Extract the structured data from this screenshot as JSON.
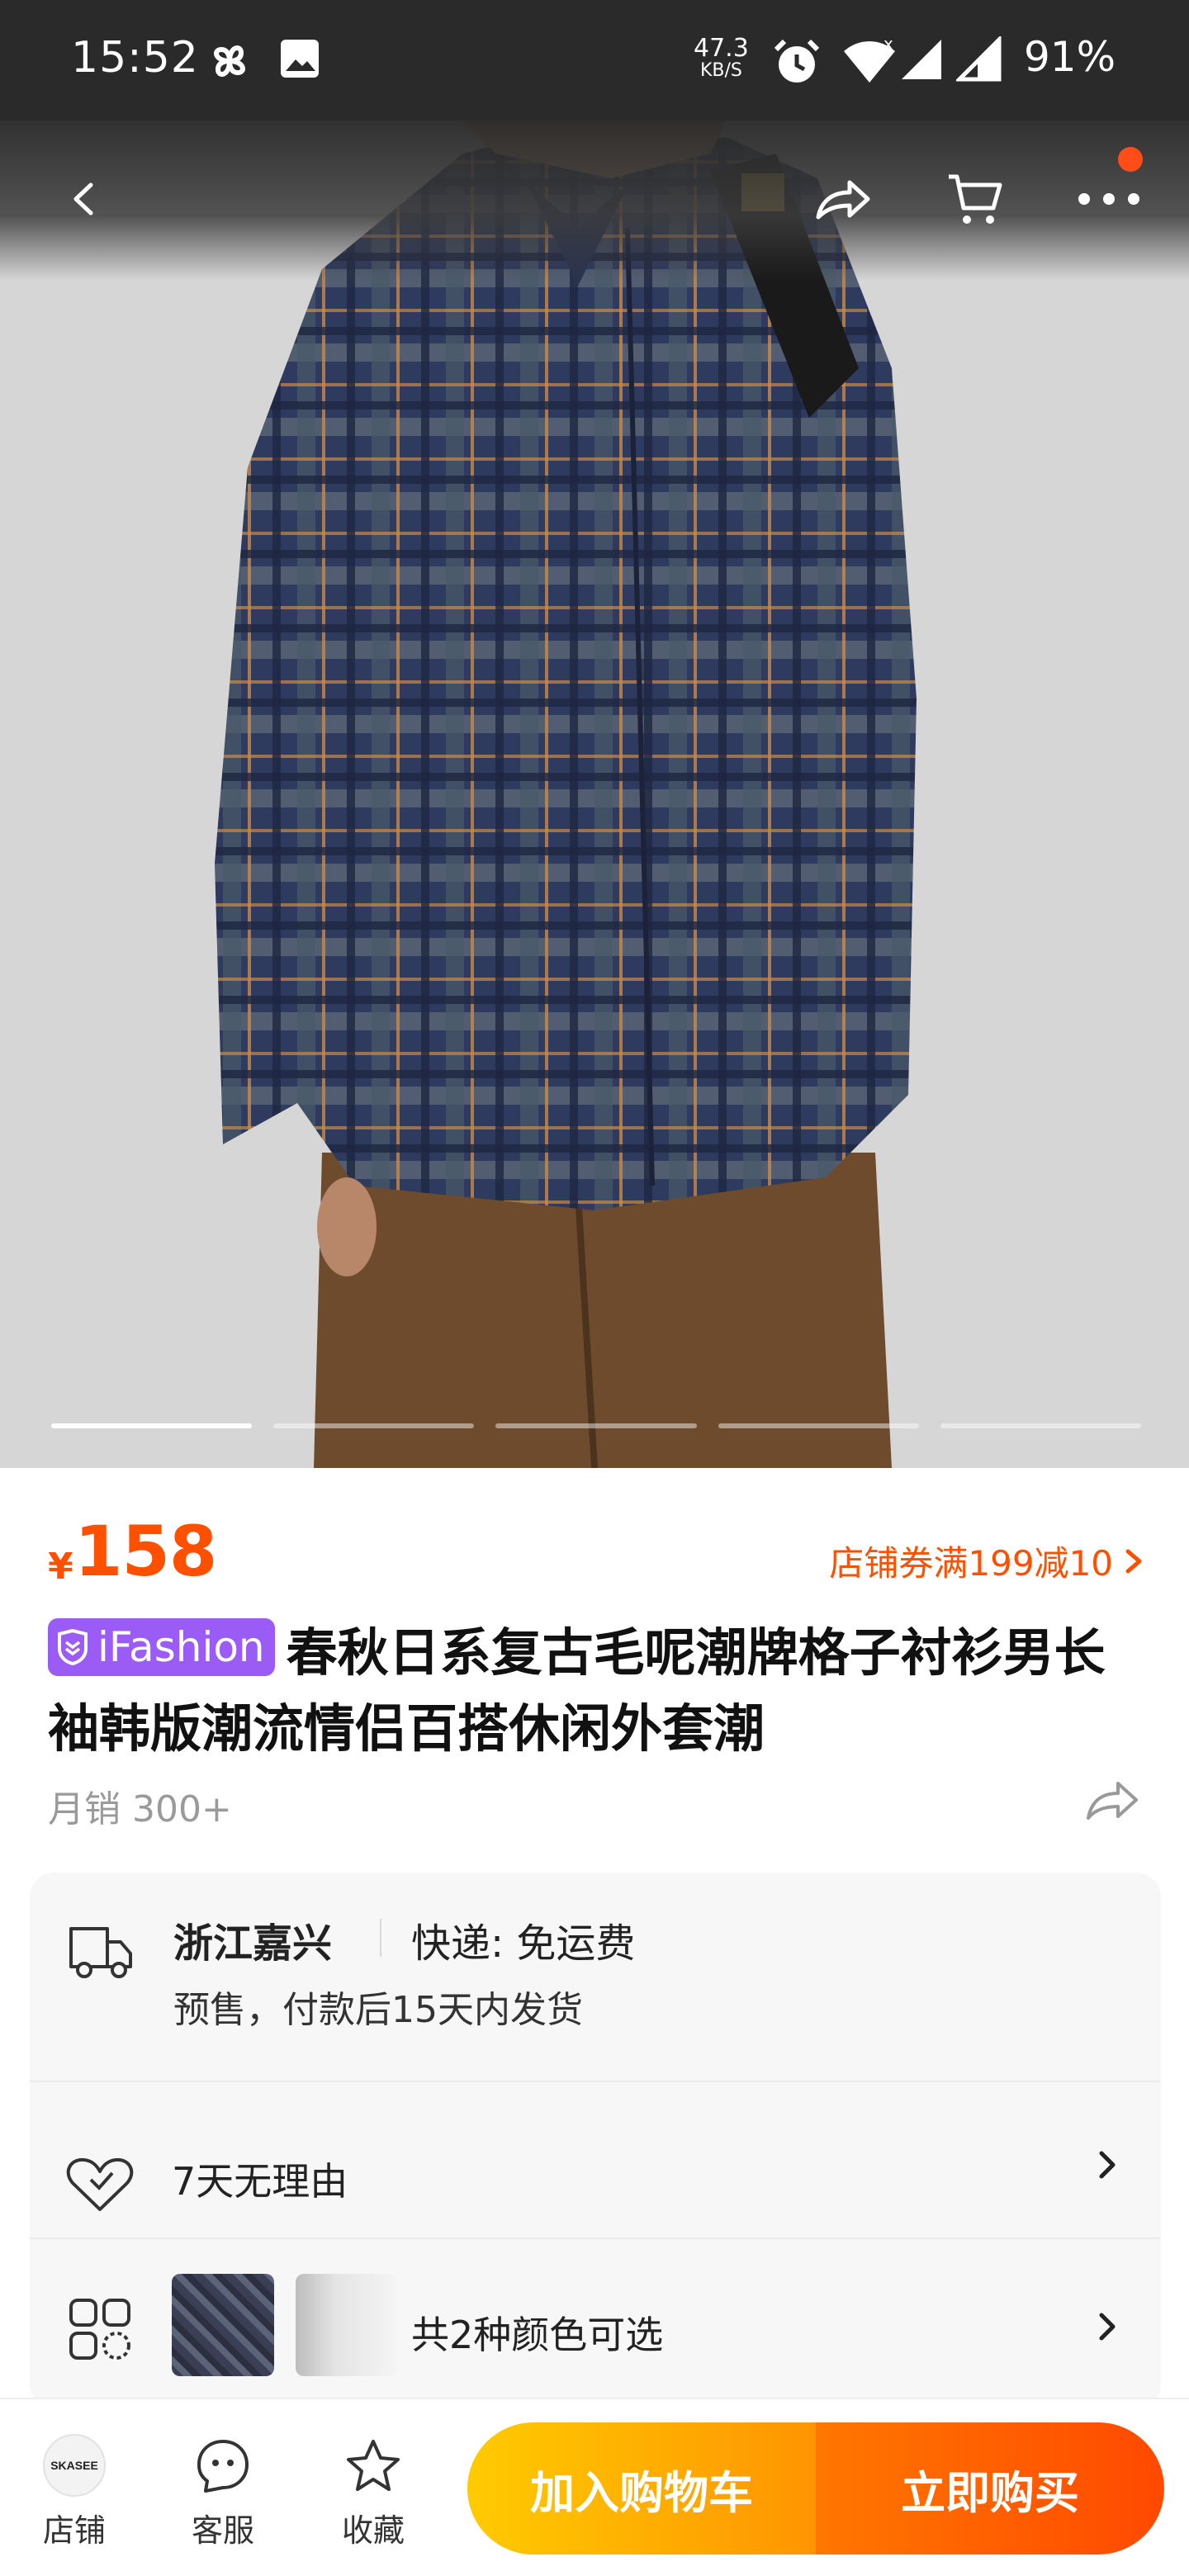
{
  "status_bar": {
    "time": "15:52",
    "net_speed_value": "47.3",
    "net_speed_unit": "KB/S",
    "battery": "91%",
    "icons": [
      "pinwheel-icon",
      "image-icon",
      "alarm-icon",
      "wifi-icon",
      "signal-icon",
      "signal-icon"
    ]
  },
  "header": {
    "icons": [
      "back-icon",
      "share-icon",
      "cart-icon",
      "more-icon"
    ],
    "has_notification": true
  },
  "gallery": {
    "total_images": 5,
    "active_index": 0
  },
  "product": {
    "currency": "¥",
    "price": "158",
    "coupon": "店铺券满199减10",
    "badge": "iFashion",
    "title": "春秋日系复古毛呢潮牌格子衬衫男长袖韩版潮流情侣百搭休闲外套潮",
    "monthly_sales": "月销 300+"
  },
  "shipping": {
    "location": "浙江嘉兴",
    "express": "快递: 免运费",
    "note": "预售，付款后15天内发货"
  },
  "returns": {
    "label": "7天无理由"
  },
  "colors": {
    "label": "共2种颜色可选"
  },
  "bottom_bar": {
    "shop_logo_text": "SKASEE",
    "shop": "店铺",
    "service": "客服",
    "favorite": "收藏",
    "add_to_cart": "加入购物车",
    "buy_now": "立即购买"
  },
  "colors_theme": {
    "price": "#ff5000",
    "badge": "#9a5cf5",
    "cart_button_start": "#ffcb00",
    "buy_button_end": "#ff4900"
  }
}
